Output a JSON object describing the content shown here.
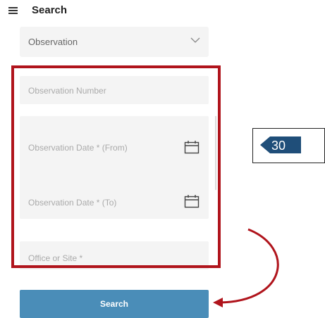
{
  "header": {
    "title": "Search",
    "menu_icon": "hamburger-icon"
  },
  "form": {
    "type_select": {
      "value": "Observation",
      "icon": "chevron-down-icon"
    },
    "observation_number": {
      "placeholder": "Observation Number"
    },
    "date_from": {
      "placeholder": "Observation Date * (From)",
      "icon": "calendar-icon"
    },
    "date_to": {
      "placeholder": "Observation Date * (To)",
      "icon": "calendar-icon"
    },
    "office_site": {
      "placeholder": "Office or Site *"
    },
    "search_label": "Search"
  },
  "annotation": {
    "step_number": "30",
    "highlight_color": "#b0141c",
    "badge_color": "#1f4e79"
  },
  "colors": {
    "button": "#4a8db8",
    "field_bg": "#f4f4f4"
  }
}
